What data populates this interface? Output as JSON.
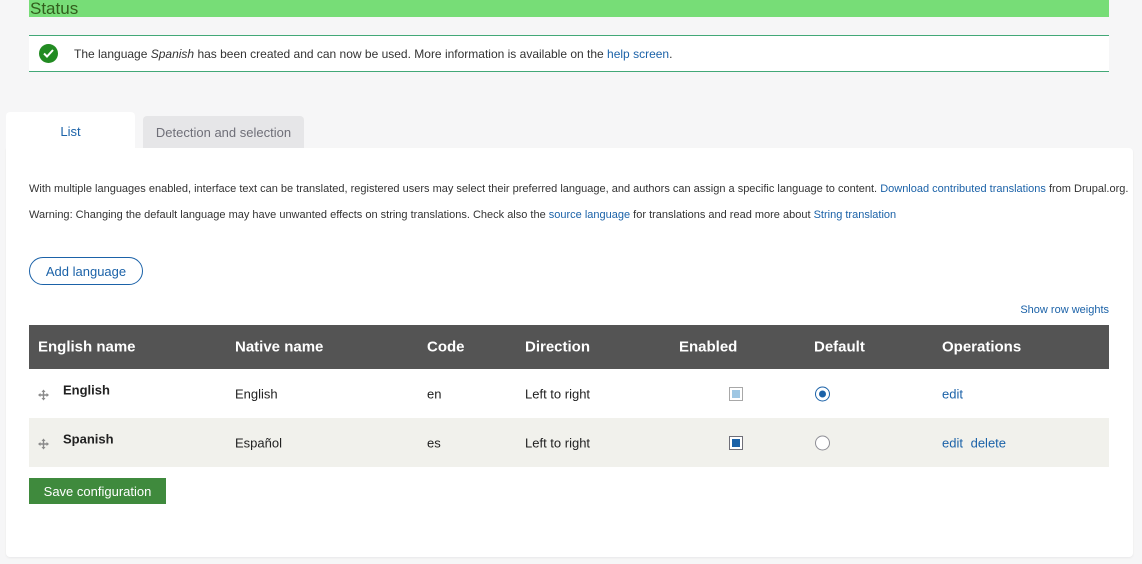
{
  "status": {
    "heading": "Status",
    "message_prefix": "The language ",
    "message_lang": "Spanish",
    "message_middle": " has been created and can now be used. More information is available on the ",
    "message_link": "help screen",
    "message_suffix": "."
  },
  "tabs": [
    {
      "label": "List",
      "active": true
    },
    {
      "label": "Detection and selection",
      "active": false
    }
  ],
  "description": {
    "line1_text": "With multiple languages enabled, interface text can be translated, registered users may select their preferred language, and authors can assign a specific language to content. ",
    "line1_link": "Download contributed translations",
    "line1_suffix": " from Drupal.org.",
    "line2_label": "Warning",
    "line2_text": ": Changing the default language may have unwanted effects on string translations. Check also the ",
    "line2_link1": "source language",
    "line2_middle": " for translations and read more about ",
    "line2_link2": "String translation"
  },
  "add_language_label": "Add language",
  "show_row_weights": "Show row weights",
  "table": {
    "headers": [
      "English name",
      "Native name",
      "Code",
      "Direction",
      "Enabled",
      "Default",
      "Operations"
    ],
    "rows": [
      {
        "english": "English",
        "native": "English",
        "code": "en",
        "direction": "Left to right",
        "enabled": true,
        "enabled_disabled": true,
        "default": true,
        "ops": [
          "edit"
        ]
      },
      {
        "english": "Spanish",
        "native": "Español",
        "code": "es",
        "direction": "Left to right",
        "enabled": true,
        "enabled_disabled": false,
        "default": false,
        "ops": [
          "edit",
          "delete"
        ]
      }
    ]
  },
  "save_label": "Save configuration",
  "colors": {
    "status_green": "#77dd77",
    "link": "#1b62a8",
    "header": "#545454",
    "save": "#3f8a3d"
  }
}
